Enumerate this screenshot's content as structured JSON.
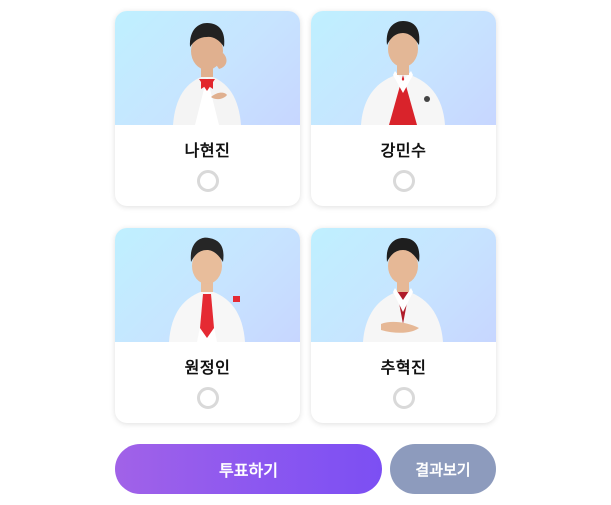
{
  "candidates": [
    {
      "name": "나현진",
      "selected": false,
      "tie_color": "#e2262c",
      "shirt_color": "#ffffff"
    },
    {
      "name": "강민수",
      "selected": false,
      "tie_color": "#d9232b",
      "shirt_color": "#d9232b"
    },
    {
      "name": "원정인",
      "selected": false,
      "tie_color": "#e52a33",
      "shirt_color": "#ffffff"
    },
    {
      "name": "추혁진",
      "selected": false,
      "tie_color": "#c81f2a",
      "shirt_color": "#b01c2a"
    }
  ],
  "actions": {
    "vote_label": "투표하기",
    "result_label": "결과보기"
  },
  "colors": {
    "photo_bg": "#c7e4ff",
    "vote_gradient_start": "#a162e8",
    "vote_gradient_end": "#7c4ff3",
    "result_bg": "#8d9bbd",
    "radio_border": "#d9d9d9"
  }
}
